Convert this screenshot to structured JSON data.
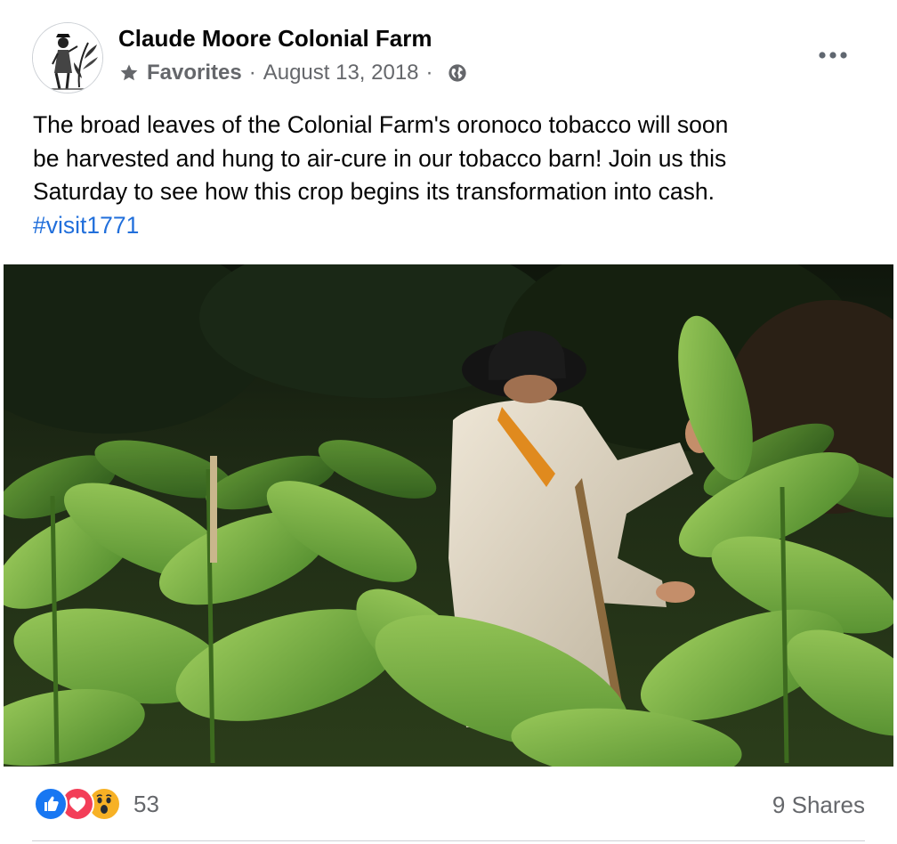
{
  "post": {
    "page_name": "Claude Moore Colonial Farm",
    "meta": {
      "list": "Favorites",
      "separator": "·",
      "date": "August 13, 2018",
      "icons": [
        "star-icon",
        "globe-icon"
      ]
    },
    "text_lines": [
      "The broad leaves of the Colonial Farm's oronoco tobacco will soon",
      "be harvested and hung to air-cure in our tobacco barn! Join us this",
      "Saturday to see how this crop begins its transformation into cash."
    ],
    "hashtag": "#visit1771",
    "more_icon": "more-horizontal-icon",
    "photo_subject": "man-in-tobacco-field"
  },
  "footer": {
    "reactions": [
      "like-icon",
      "love-icon",
      "wow-icon"
    ],
    "reaction_count": "53",
    "shares": "9 Shares"
  },
  "colors": {
    "text": "#050505",
    "secondary": "#65676b",
    "link": "#216fdb",
    "like": "#1877f2",
    "love": "#f33e58",
    "wow": "#f7b125"
  }
}
